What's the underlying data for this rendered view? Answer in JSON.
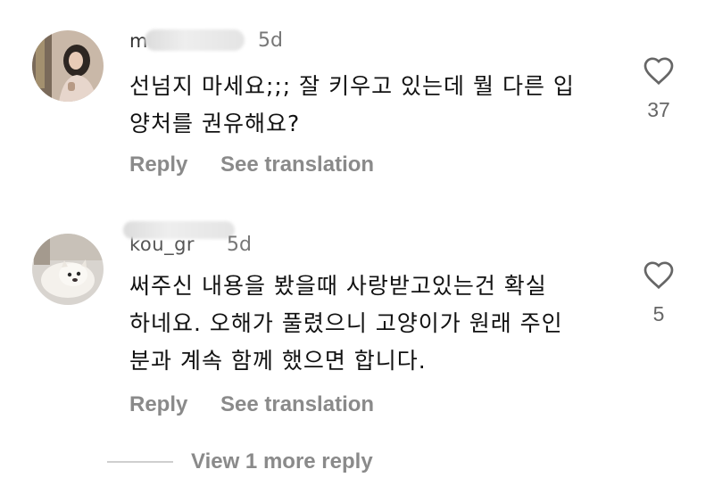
{
  "comments": [
    {
      "username_partial": "m",
      "time": "5d",
      "text_lines": [
        "선넘지 마세요;;; 잘 키우고 있는데 뭘 다른 입",
        "양처를 권유해요?"
      ],
      "like_count": "37",
      "reply_label": "Reply",
      "translate_label": "See translation",
      "avatar_icon": "user-avatar-woman-photo"
    },
    {
      "username_partial": "kou_gr",
      "time": "5d",
      "text_lines": [
        "써주신 내용을 봤을때 사랑받고있는건 확실",
        "하네요. 오해가 풀렸으니 고양이가 원래 주인",
        "분과 계속 함께 했으면 합니다."
      ],
      "like_count": "5",
      "reply_label": "Reply",
      "translate_label": "See translation",
      "avatar_icon": "user-avatar-dog-photo"
    }
  ],
  "view_more_label": "View 1 more reply",
  "icons": {
    "like": "heart-outline-icon"
  },
  "colors": {
    "text": "#111111",
    "muted": "#8a8a8a",
    "time": "#777777"
  }
}
